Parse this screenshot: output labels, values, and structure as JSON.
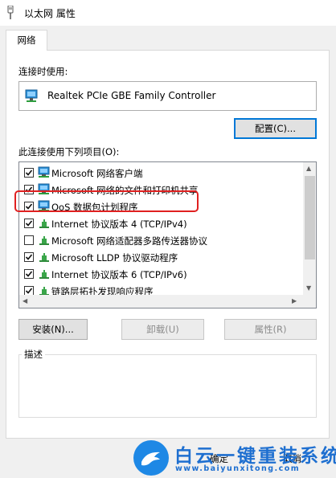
{
  "window": {
    "title": "以太网 属性"
  },
  "tab": {
    "label": "网络"
  },
  "connect_using": {
    "label": "连接时使用:",
    "adapter_name": "Realtek PCIe GBE Family Controller",
    "configure_button": "配置(C)..."
  },
  "items_section": {
    "label": "此连接使用下列项目(O):",
    "items": [
      {
        "label": "Microsoft 网络客户端",
        "checked": true,
        "icon": "network-client-icon"
      },
      {
        "label": "Microsoft 网络的文件和打印机共享",
        "checked": true,
        "icon": "network-share-icon"
      },
      {
        "label": "QoS 数据包计划程序",
        "checked": true,
        "icon": "network-service-icon"
      },
      {
        "label": "Internet 协议版本 4 (TCP/IPv4)",
        "checked": true,
        "icon": "protocol-icon"
      },
      {
        "label": "Microsoft 网络适配器多路传送器协议",
        "checked": false,
        "icon": "protocol-icon"
      },
      {
        "label": "Microsoft LLDP 协议驱动程序",
        "checked": true,
        "icon": "protocol-icon"
      },
      {
        "label": "Internet 协议版本 6 (TCP/IPv6)",
        "checked": true,
        "icon": "protocol-icon"
      },
      {
        "label": "链路层拓扑发现响应程序",
        "checked": true,
        "icon": "protocol-icon"
      }
    ]
  },
  "buttons": {
    "install": "安装(N)...",
    "uninstall": "卸载(U)",
    "properties": "属性(R)",
    "ok": "确定",
    "cancel": "取消"
  },
  "description": {
    "label": "描述"
  },
  "watermark": {
    "main": "白云一键重装系统",
    "url": "www.baiyunxitong.com"
  },
  "colors": {
    "highlight": "#e02020",
    "accent": "#0078d7",
    "watermark": "#1e6fd0"
  }
}
